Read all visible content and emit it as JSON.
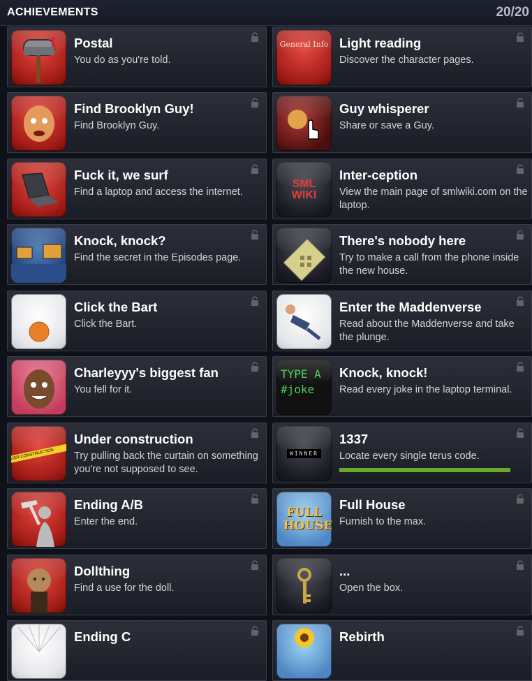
{
  "header": {
    "title": "ACHIEVEMENTS",
    "count": "20/20"
  },
  "colors": {
    "progress": "#69a92e",
    "card": "#2c2e39"
  },
  "achievements": [
    {
      "name": "Postal",
      "desc": "You do as you're told.",
      "icon": "mailbox-icon",
      "thumb": "red"
    },
    {
      "name": "Light reading",
      "desc": "Discover the character pages.",
      "icon": "general-info-page-icon",
      "thumb": "red",
      "thumb_text": "General Info"
    },
    {
      "name": "Find Brooklyn Guy!",
      "desc": "Find Brooklyn Guy.",
      "icon": "brooklyn-guy-icon",
      "thumb": "red"
    },
    {
      "name": "Guy whisperer",
      "desc": "Share or save a Guy.",
      "icon": "cursor-hand-icon",
      "thumb": "dark"
    },
    {
      "name": "Fuck it, we surf",
      "desc": "Find a laptop and access the internet.",
      "icon": "laptop-icon",
      "thumb": "red"
    },
    {
      "name": "Inter-ception",
      "desc": "View the main page of smlwiki.com on the laptop.",
      "icon": "sml-wiki-logo-icon",
      "thumb": "dark",
      "thumb_text": "SML WIKI"
    },
    {
      "name": "Knock, knock?",
      "desc": "Find the secret in the Episodes page.",
      "icon": "episodes-page-icon",
      "thumb": "blue"
    },
    {
      "name": "There's nobody here",
      "desc": "Try to make a call from the phone inside the new house.",
      "icon": "telephone-icon",
      "thumb": "dark"
    },
    {
      "name": "Click the Bart",
      "desc": "Click the Bart.",
      "icon": "orange-ball-icon",
      "thumb": "white"
    },
    {
      "name": "Enter the Maddenverse",
      "desc": "Read about the Maddenverse and take the plunge.",
      "icon": "falling-man-icon",
      "thumb": "white"
    },
    {
      "name": "Charleyyy's biggest fan",
      "desc": "You fell for it.",
      "icon": "charleyyy-face-icon",
      "thumb": "pink"
    },
    {
      "name": "Knock, knock!",
      "desc": "Read every joke in the laptop terminal.",
      "icon": "terminal-icon",
      "thumb": "dark",
      "thumb_text_1": "TYPE A",
      "thumb_text_2": "#joke"
    },
    {
      "name": "Under construction",
      "desc": "Try pulling back the curtain on something you're not supposed to see.",
      "icon": "construction-tape-icon",
      "thumb": "red",
      "thumb_text": "UNDER CONSTRUCTION"
    },
    {
      "name": "1337",
      "desc": "Locate every single terus code.",
      "icon": "winner-display-icon",
      "thumb": "dark",
      "thumb_text": "WINNER",
      "progress": 1.0
    },
    {
      "name": "Ending A/B",
      "desc": "Enter the end.",
      "icon": "hammer-silhouette-icon",
      "thumb": "red"
    },
    {
      "name": "Full House",
      "desc": "Furnish to the max.",
      "icon": "full-house-logo-icon",
      "thumb": "blue",
      "thumb_text": "FULL HOUSE"
    },
    {
      "name": "Dollthing",
      "desc": "Find a use for the doll.",
      "icon": "voodoo-doll-icon",
      "thumb": "red"
    },
    {
      "name": "...",
      "desc": "Open the box.",
      "icon": "key-icon",
      "thumb": "dark"
    },
    {
      "name": "Ending C",
      "desc": "",
      "icon": "light-rays-icon",
      "thumb": "white"
    },
    {
      "name": "Rebirth",
      "desc": "",
      "icon": "sunflower-icon",
      "thumb": "blue"
    }
  ]
}
